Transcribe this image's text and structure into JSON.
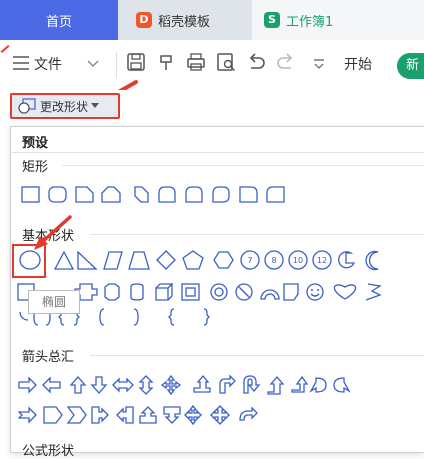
{
  "tabs": {
    "home": "首页",
    "docer": "稻壳模板",
    "workbook": "工作簿1"
  },
  "toolbar": {
    "menu_label": "文件",
    "start_label": "开始",
    "green_label": "新"
  },
  "shape_button": {
    "label": "更改形状"
  },
  "panel": {
    "title": "预设",
    "sections": {
      "rect": "矩形",
      "basic": "基本形状",
      "arrows": "箭头总汇",
      "formula": "公式形状"
    }
  },
  "tooltip": {
    "text": "椭圆"
  },
  "colors": {
    "accent_blue": "#4d6ae6",
    "brand_green": "#1aa06d",
    "highlight_red": "#e23b2e",
    "docer_orange": "#f0552c"
  }
}
